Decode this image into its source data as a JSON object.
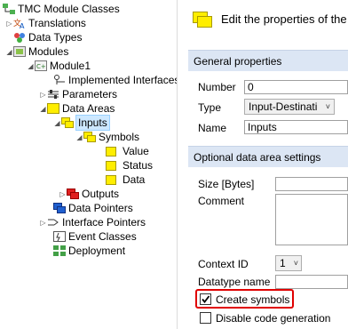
{
  "tree": {
    "items": [
      {
        "label": "TMC Module Classes",
        "icon": "tmc-class-icon"
      },
      {
        "label": "Translations",
        "icon": "translations-icon"
      },
      {
        "label": "Data Types",
        "icon": "data-types-icon"
      },
      {
        "label": "Modules",
        "icon": "modules-icon"
      },
      {
        "label": "Module1",
        "icon": "module-icon"
      },
      {
        "label": "Implemented Interfaces",
        "icon": "interfaces-icon"
      },
      {
        "label": "Parameters",
        "icon": "parameters-icon"
      },
      {
        "label": "Data Areas",
        "icon": "data-areas-icon"
      },
      {
        "label": "Inputs",
        "icon": "inputs-icon"
      },
      {
        "label": "Symbols",
        "icon": "symbols-icon"
      },
      {
        "label": "Value",
        "icon": "symbol-icon"
      },
      {
        "label": "Status",
        "icon": "symbol-icon"
      },
      {
        "label": "Data",
        "icon": "symbol-icon"
      },
      {
        "label": "Outputs",
        "icon": "outputs-icon"
      },
      {
        "label": "Data Pointers",
        "icon": "data-pointers-icon"
      },
      {
        "label": "Interface Pointers",
        "icon": "interface-pointers-icon"
      },
      {
        "label": "Event Classes",
        "icon": "event-classes-icon"
      },
      {
        "label": "Deployment",
        "icon": "deployment-icon"
      }
    ]
  },
  "panel": {
    "title": "Edit the properties of the",
    "general_section": "General properties",
    "number_label": "Number",
    "number_value": "0",
    "type_label": "Type",
    "type_value": "Input-Destinati",
    "name_label": "Name",
    "name_value": "Inputs",
    "optional_section": "Optional data area settings",
    "size_label": "Size [Bytes]",
    "comment_label": "Comment",
    "context_label": "Context ID",
    "context_value": "1",
    "datatype_label": "Datatype name",
    "create_symbols_label": "Create symbols",
    "create_symbols_checked": true,
    "disable_codegen_label": "Disable code generation",
    "disable_codegen_checked": false
  },
  "colors": {
    "highlight": "#e00000",
    "section_bg": "#dce6f4",
    "folder_yellow": "#ffee00",
    "selection": "#cde8ff"
  }
}
